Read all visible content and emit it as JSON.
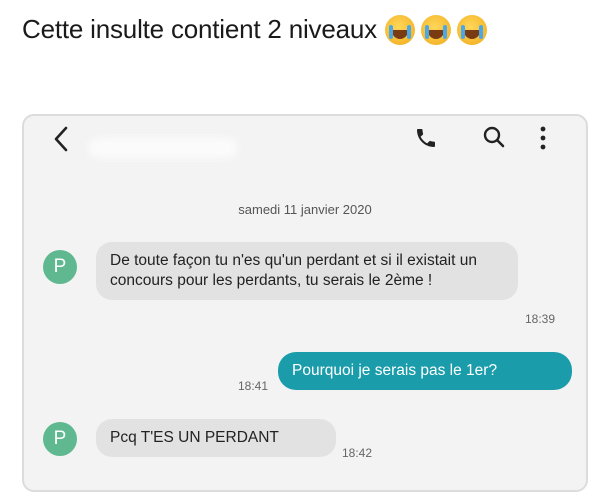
{
  "caption": {
    "text": "Cette insulte contient 2 niveaux",
    "emojis": [
      "crying-face-emoji",
      "crying-face-emoji",
      "crying-face-emoji"
    ]
  },
  "toolbar": {
    "icons": [
      "back-arrow-icon",
      "phone-icon",
      "search-icon",
      "more-vert-icon"
    ]
  },
  "conversation": {
    "date": "samedi 11 janvier 2020",
    "avatar_initial": "P",
    "messages": [
      {
        "direction": "in",
        "text": "De toute façon tu n'es qu'un perdant et si il existait un concours pour les perdants, tu serais le 2ème !",
        "time": "18:39"
      },
      {
        "direction": "out",
        "text": "Pourquoi je serais pas le 1er?",
        "time": "18:41"
      },
      {
        "direction": "in",
        "text": "Pcq T'ES UN PERDANT",
        "time": "18:42"
      }
    ]
  },
  "colors": {
    "outgoing_bubble": "#1a9cab",
    "incoming_bubble": "#e2e2e2",
    "avatar": "#5fb88f",
    "screen_bg": "#f3f3f3"
  }
}
